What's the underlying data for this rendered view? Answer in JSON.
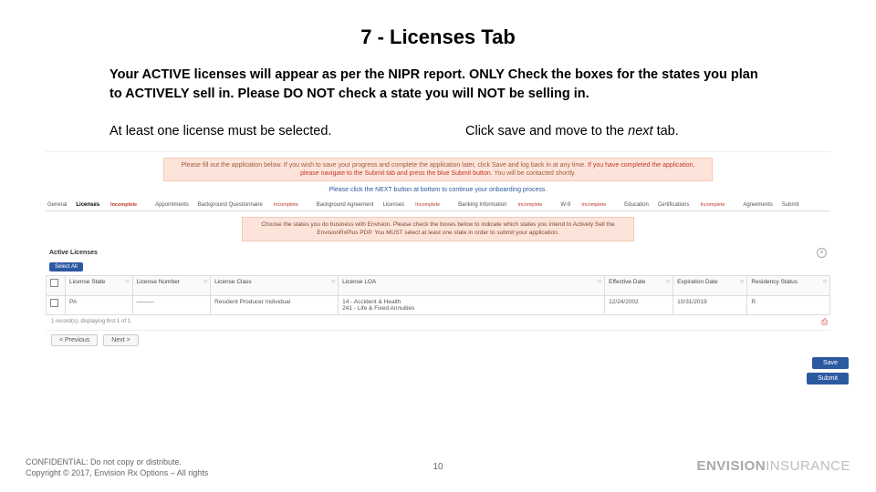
{
  "title": "7 - Licenses Tab",
  "para": "Your ACTIVE licenses will appear as per the NIPR report. ONLY Check the boxes for the states you plan to ACTIVELY sell in.  Please DO NOT check a state you will NOT be selling in.",
  "hints": {
    "left": "At least one license must be selected.",
    "right_pre": "Click save and move to the ",
    "right_em": "next",
    "right_post": " tab."
  },
  "banner1_pre": "Please fill out the application below. If you wish to save your progress and complete the application later, click Save and log back in at any time. ",
  "banner1_red": "If you have completed the application, please navigate to the Submit tab and press the blue Submit button.",
  "banner1_post": " You will be contacted shortly.",
  "blue_inline": "Please click the NEXT button at bottom to continue your onboarding process.",
  "tabs": {
    "t0": "General",
    "t1": "Licenses",
    "t2": "Appointments",
    "t3": "Background Questionnaire",
    "t4": "Background Agreement",
    "t5": "Licenses",
    "t6": "Banking Information",
    "t7": "W-9",
    "t8": "Education",
    "t9": "Certifications",
    "t10": "Agreements",
    "t11": "Submit",
    "inc": "Incomplete"
  },
  "orange_small": "Choose the states you do business with Envision. Please check the boxes below to indicate which states you intend to Actively Sell the EnvisionRxPlus PDP. You MUST select at least one state in order to submit your application.",
  "active_label": "Active Licenses",
  "select_all": "Select All",
  "table": {
    "hdr": {
      "c0": "",
      "c1": "License State",
      "c2": "License Number",
      "c3": "License Class",
      "c4": "License LOA",
      "c5": "Effective Date",
      "c6": "Expiration Date",
      "c7": "Residency Status"
    },
    "row": {
      "state": "PA",
      "num": "———",
      "class": "Resident Producer Individual",
      "loa": "14 - Accident & Health\n241 - Life & Fixed Annuities",
      "eff": "12/24/2002",
      "exp": "10/31/2019",
      "res": "R"
    }
  },
  "tiny_note": "1 record(s), displaying first 1 of 1.",
  "prev": "< Previous",
  "next": "Next >",
  "save": "Save",
  "submit": "Submit",
  "footer1": "CONFIDENTIAL: Do not copy or distribute.",
  "footer2": "Copyright © 2017, Envision Rx Options – All rights",
  "page": "10",
  "brand_bold": "ENVISION",
  "brand_light": "INSURANCE"
}
